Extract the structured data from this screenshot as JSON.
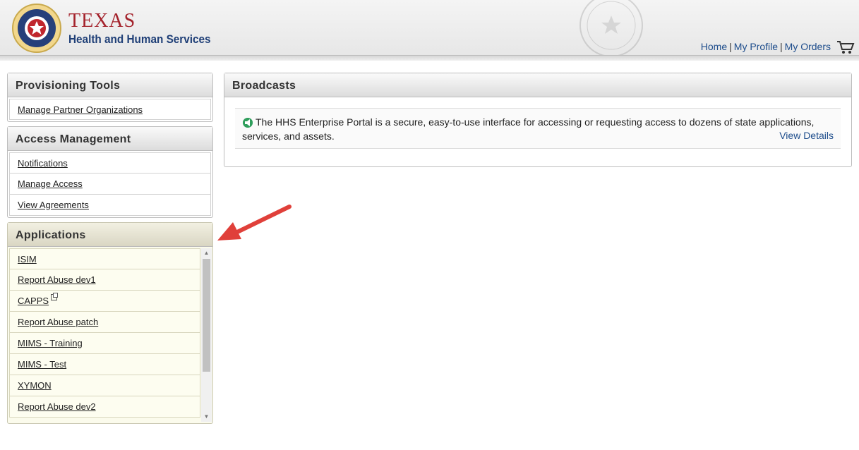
{
  "header": {
    "brand_title": "TEXAS",
    "brand_subtitle": "Health and Human Services",
    "nav": [
      {
        "label": "Home"
      },
      {
        "label": "My Profile"
      },
      {
        "label": "My Orders"
      }
    ],
    "separator": "|",
    "icons": {
      "logo": "texas-star-logo",
      "seal": "state-seal",
      "cart": "cart-icon"
    }
  },
  "sidebar": {
    "provisioning": {
      "title": "Provisioning Tools",
      "items": [
        {
          "label": "Manage Partner Organizations"
        }
      ]
    },
    "access": {
      "title": "Access Management",
      "items": [
        {
          "label": "Notifications"
        },
        {
          "label": "Manage Access"
        },
        {
          "label": "View Agreements"
        }
      ]
    },
    "applications": {
      "title": "Applications",
      "items": [
        {
          "label": "ISIM"
        },
        {
          "label": "Report Abuse dev1"
        },
        {
          "label": "CAPPS"
        },
        {
          "label": "Report Abuse patch"
        },
        {
          "label": "MIMS - Training"
        },
        {
          "label": "MIMS - Test"
        },
        {
          "label": "XYMON"
        },
        {
          "label": "Report Abuse dev2"
        }
      ]
    }
  },
  "broadcasts": {
    "title": "Broadcasts",
    "message": "The HHS Enterprise Portal is a secure, easy-to-use interface for accessing or requesting access to dozens of state applications, services, and assets.",
    "link": "View Details"
  },
  "colors": {
    "brand_red": "#a4232c",
    "brand_blue": "#1f3f77",
    "link": "#1e4d8c",
    "annotation_arrow": "#e0403a"
  }
}
